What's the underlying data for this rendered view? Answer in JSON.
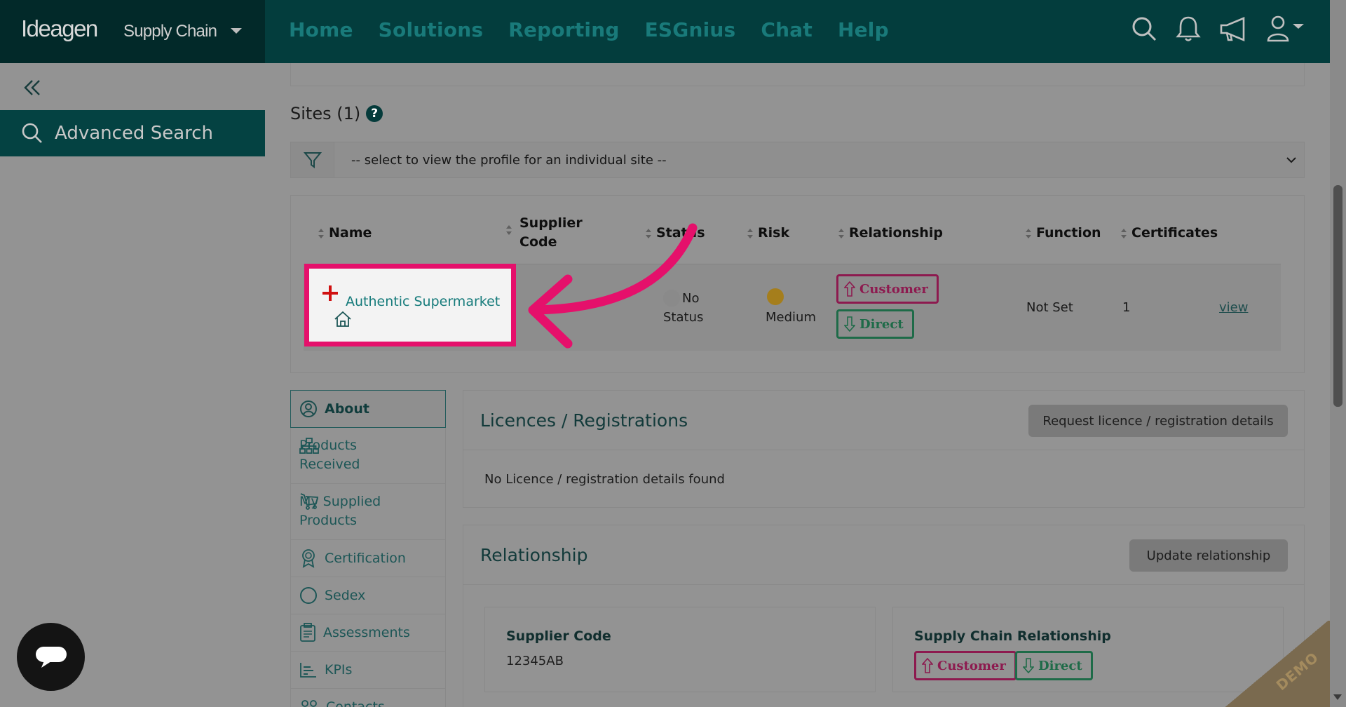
{
  "brand": {
    "logo": "Ideagen",
    "product": "Supply Chain"
  },
  "nav": [
    "Home",
    "Solutions",
    "Reporting",
    "ESGnius",
    "Chat",
    "Help"
  ],
  "top_icons": [
    "search-icon",
    "bell-icon",
    "megaphone-icon",
    "user-icon"
  ],
  "sidebar": {
    "advanced_search": "Advanced Search"
  },
  "sites": {
    "title": "Sites (1)",
    "help": "?",
    "select_placeholder": "-- select to view the profile for an individual site --"
  },
  "table": {
    "headers": {
      "name": "Name",
      "supplier_code": "Supplier\nCode",
      "status": "Status",
      "risk": "Risk",
      "relationship": "Relationship",
      "function": "Function",
      "certificates": "Certificates"
    },
    "row": {
      "name": "Authentic Supermarket",
      "status_line1": "No",
      "status_line2": "Status",
      "risk": "Medium",
      "relationship_customer": "Customer",
      "relationship_direct": "Direct",
      "function": "Not Set",
      "certificates": "1",
      "view": "view",
      "risk_color": "#a57e1c",
      "status_color": "#8a8a8a"
    }
  },
  "menu": [
    {
      "name": "about",
      "label": "About",
      "icon": "user-circle-icon",
      "active": true
    },
    {
      "name": "products-received",
      "label": "Products\nReceived",
      "icon": "hierarchy-icon"
    },
    {
      "name": "my-supplied-products",
      "label": "My Supplied\nProducts",
      "icon": "cart-icon"
    },
    {
      "name": "certification",
      "label": "Certification",
      "icon": "award-icon"
    },
    {
      "name": "sedex",
      "label": "Sedex",
      "icon": "circle-icon"
    },
    {
      "name": "assessments",
      "label": "Assessments",
      "icon": "clipboard-icon"
    },
    {
      "name": "kpis",
      "label": "KPIs",
      "icon": "bar-chart-icon"
    },
    {
      "name": "contacts",
      "label": "Contacts",
      "icon": "people-icon"
    }
  ],
  "licences": {
    "title": "Licences / Registrations",
    "button": "Request licence / registration details",
    "empty": "No Licence / registration details found"
  },
  "relationship": {
    "title": "Relationship",
    "button": "Update relationship",
    "supplier_code_label": "Supplier Code",
    "supplier_code_value": "12345AB",
    "chain_label": "Supply Chain Relationship",
    "customer": "Customer",
    "direct": "Direct"
  },
  "demo_ribbon": "DEMO",
  "colors": {
    "highlight": "#e5106b",
    "brand_dark": "#022929",
    "nav_bg": "#033d3d",
    "customer": "#8d1a4f",
    "direct": "#1e6b48"
  }
}
